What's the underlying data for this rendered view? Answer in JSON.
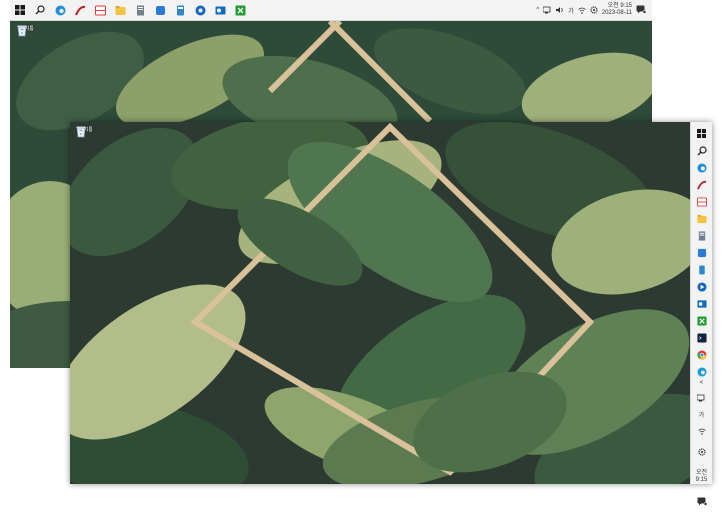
{
  "display_top": {
    "taskbar": {
      "pinned_icons": [
        "windows-start-icon",
        "search-icon",
        "edge-icon",
        "autodesk-icon",
        "app-red-icon",
        "file-explorer-icon",
        "notepad-icon",
        "settings-blue-icon",
        "calculator-icon",
        "google-chrome-icon",
        "outlook-icon",
        "xbox-icon"
      ],
      "tray": {
        "chevron": "^",
        "lang": "가",
        "time": "오전 9:15",
        "date": "2023-08-11"
      }
    },
    "desktop_icons": [
      {
        "label": "휴지통",
        "icon": "recycle-bin-icon"
      }
    ]
  },
  "display_front": {
    "desktop_icons": [
      {
        "label": "휴지통",
        "icon": "recycle-bin-icon"
      }
    ],
    "taskbar": {
      "pinned_icons": [
        "windows-start-icon",
        "search-icon",
        "edge-icon",
        "autodesk-icon",
        "app-red-icon",
        "file-explorer-icon",
        "notepad-icon",
        "settings-blue-icon",
        "phone-icon",
        "calculator-icon",
        "outlook-icon",
        "xbox-icon",
        "terminal-icon",
        "chrome-icon",
        "edge-icon"
      ],
      "tray": {
        "chevron": "<",
        "lang": "가",
        "time": "오전 9:15"
      }
    }
  },
  "colors": {
    "taskbar_bg": "#f3f3f3",
    "leaf_dark": "#2e4a38",
    "leaf_mid": "#4f6f4a",
    "leaf_light": "#9fb07a",
    "frame_gold": "#d9c19a",
    "shadow_bg": "#2c3232"
  }
}
